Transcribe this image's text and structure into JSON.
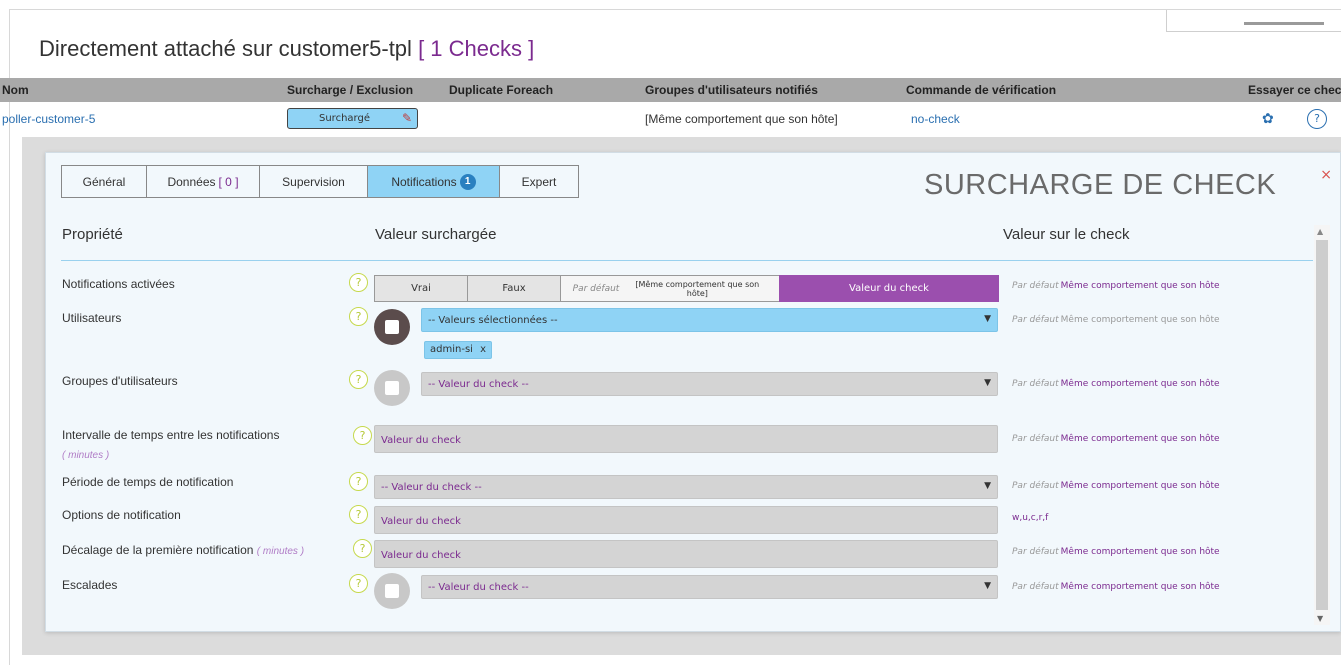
{
  "page": {
    "title_prefix": "Directement attaché sur customer5-tpl",
    "title_count": "[ 1  Checks ]"
  },
  "table": {
    "headers": [
      "Nom",
      "Surcharge / Exclusion",
      "Duplicate Foreach",
      "Groupes d'utilisateurs notifiés",
      "Commande de vérification",
      "Essayer ce check"
    ],
    "row": {
      "name": "poller-customer-5",
      "override_label": "Surchargé",
      "notified_groups": "[Même comportement que son hôte]",
      "command": "no-check"
    }
  },
  "modal": {
    "title": "SURCHARGE DE CHECK",
    "close": "×",
    "tabs": [
      {
        "label": "Général"
      },
      {
        "label": "Données",
        "bracket": "[ 0 ]"
      },
      {
        "label": "Supervision"
      },
      {
        "label": "Notifications",
        "badge": "1"
      },
      {
        "label": "Expert"
      }
    ],
    "active_tab": "Notifications",
    "col_property": "Propriété",
    "col_overridden": "Valeur surchargée",
    "col_check_value": "Valeur sur le check",
    "default_prefix": "Par défaut",
    "same_as_host": "Même comportement que son hôte",
    "rows": {
      "notifications_enabled": {
        "label": "Notifications activées",
        "opt_true": "Vrai",
        "opt_false": "Faux",
        "opt_default_prefix": "Par défaut",
        "opt_default_value": "[Même comportement que son hôte]",
        "opt_check": "Valeur du check"
      },
      "users": {
        "label": "Utilisateurs",
        "select": "-- Valeurs sélectionnées --",
        "tag": "admin-si",
        "tag_remove": "x"
      },
      "user_groups": {
        "label": "Groupes d'utilisateurs",
        "select": "-- Valeur du check --"
      },
      "interval": {
        "label": "Intervalle de temps entre les notifications",
        "unit": "( minutes )",
        "placeholder": "Valeur du check"
      },
      "period": {
        "label": "Période de temps de notification",
        "select": "-- Valeur du check --"
      },
      "options": {
        "label": "Options de notification",
        "placeholder": "Valeur du check",
        "check_value": "w,u,c,r,f"
      },
      "first_delay": {
        "label": "Décalage de la première notification",
        "unit": "( minutes )",
        "placeholder": "Valeur du check"
      },
      "escalations": {
        "label": "Escalades",
        "select": "-- Valeur du check --"
      }
    }
  },
  "icons": {
    "help": "?",
    "gear": "✿",
    "caret": "▼",
    "edit": "✎"
  },
  "colors": {
    "accent_purple": "#7b2a8f",
    "selected_blue": "#8fd3f5",
    "check_value_purple": "#9b4fae",
    "header_grey": "#a9a9a9"
  }
}
